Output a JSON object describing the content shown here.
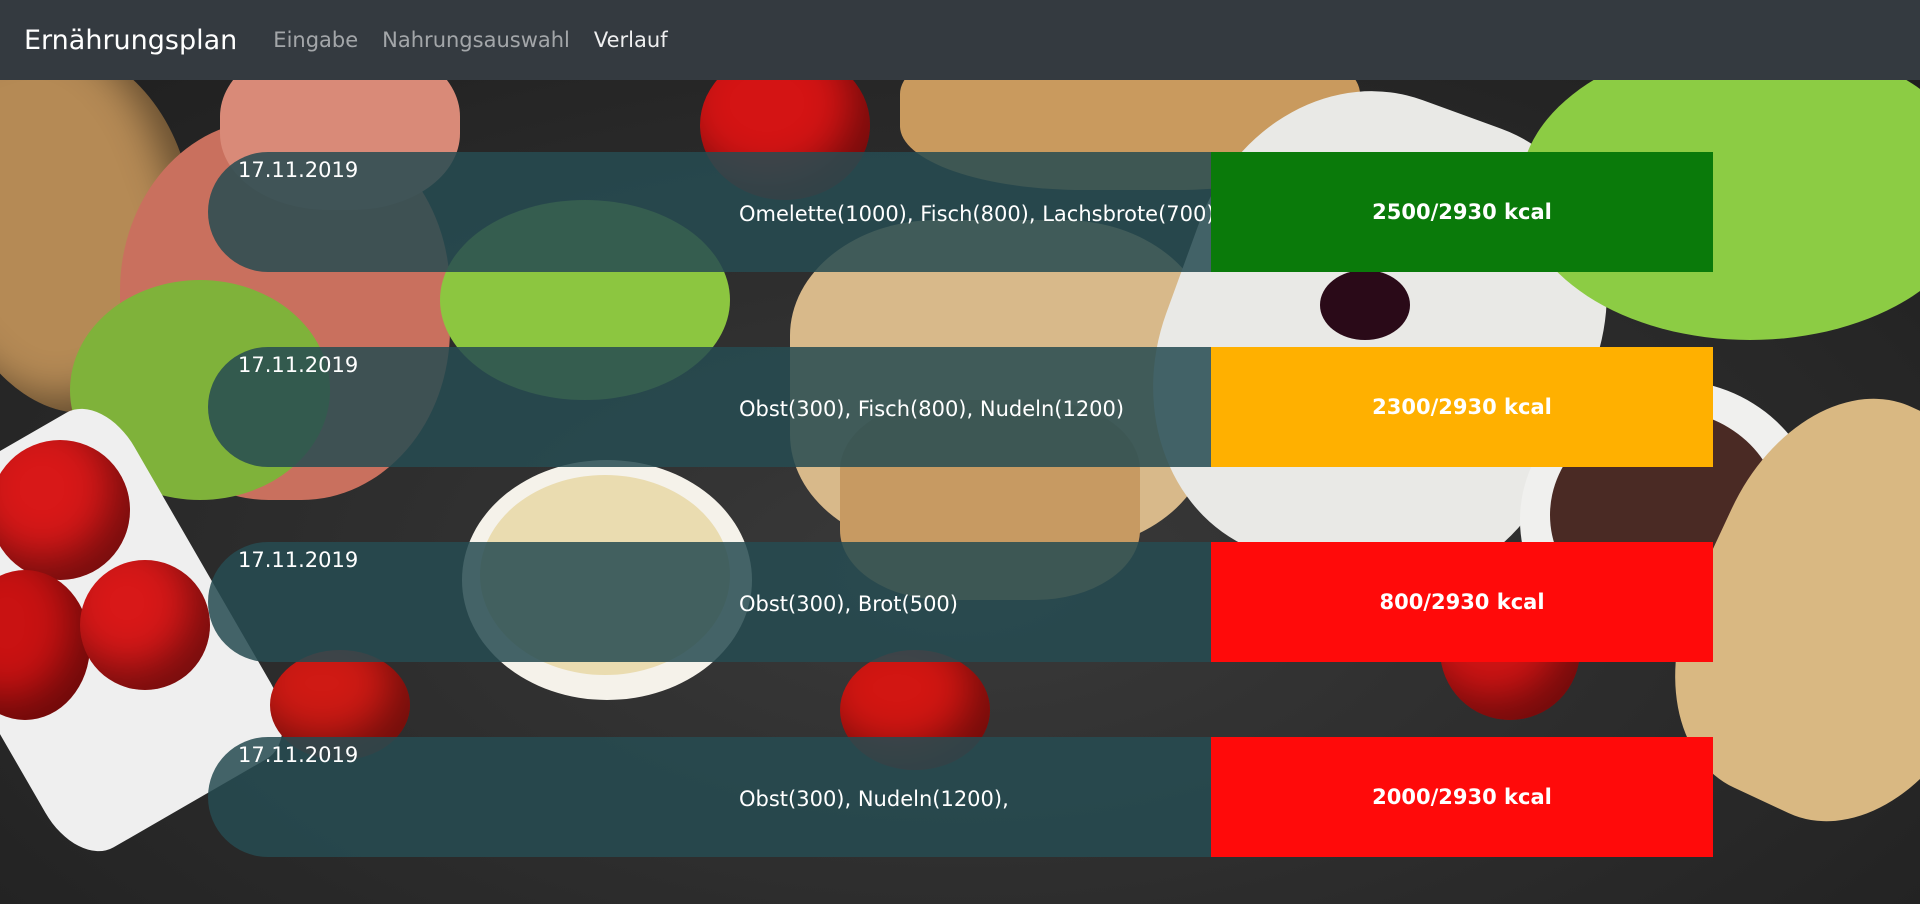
{
  "navbar": {
    "brand": "Ernährungsplan",
    "links": [
      {
        "label": "Eingabe",
        "active": false
      },
      {
        "label": "Nahrungsauswahl",
        "active": false
      },
      {
        "label": "Verlauf",
        "active": true
      }
    ]
  },
  "entries": [
    {
      "date": "17.11.2019",
      "foods": "Omelette(1000), Fisch(800), Lachsbrote(700)",
      "kcal": "2500/2930 kcal",
      "status_color": "#0a7a0a"
    },
    {
      "date": "17.11.2019",
      "foods": "Obst(300), Fisch(800), Nudeln(1200)",
      "kcal": "2300/2930 kcal",
      "status_color": "#ffb000"
    },
    {
      "date": "17.11.2019",
      "foods": "Obst(300), Brot(500)",
      "kcal": "800/2930 kcal",
      "status_color": "#ff0a0a"
    },
    {
      "date": "17.11.2019",
      "foods": "Obst(300), Nudeln(1200),",
      "kcal": "2000/2930 kcal",
      "status_color": "#ff0a0a"
    }
  ]
}
